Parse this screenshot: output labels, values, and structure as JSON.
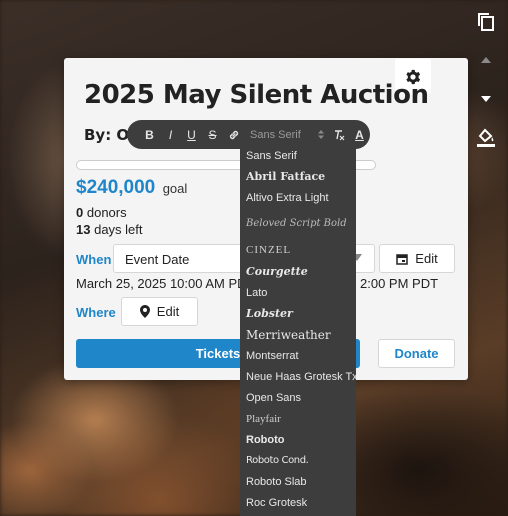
{
  "side_toolbar": {
    "copy_icon": "copy-icon",
    "up_icon": "triangle-up-icon",
    "down_icon": "triangle-down-icon",
    "fill_icon": "paint-bucket-icon"
  },
  "card": {
    "title": "2025 May Silent Auction",
    "byline": "By: Or",
    "goal_amount": "$240,000",
    "goal_word": "goal",
    "donors_count": "0",
    "donors_label": "donors",
    "days_count": "13",
    "days_label": "days left",
    "progress": 0,
    "when_label": "When",
    "event_date_value": "Event Date",
    "edit_label": "Edit",
    "start_datetime": "March 25, 2025 10:00 AM PDT",
    "end_datetime": "2:00 PM PDT",
    "where_label": "Where",
    "tickets_label": "Tickets",
    "donate_label": "Donate"
  },
  "format_toolbar": {
    "bold": "B",
    "italic": "I",
    "underline": "U",
    "strike": "S",
    "font_selected": "Sans Serif",
    "clear_format_icon": "clear-format-icon",
    "text_color": "A"
  },
  "font_options": [
    "Sans Serif",
    "Abril Fatface",
    "Altivo Extra Light",
    "Beloved Script Bold",
    "CINZEL",
    "Courgette",
    "Lato",
    "Lobster",
    "Merriweather",
    "Montserrat",
    "Neue Haas Grotesk Txt",
    "Open Sans",
    "Playfair",
    "Roboto",
    "Roboto Cond.",
    "Roboto Slab",
    "Roc Grotesk"
  ],
  "colors": {
    "accent": "#1f86c9",
    "toolbar_bg": "#3d3d3d",
    "card_bg": "#f4f4f4"
  }
}
